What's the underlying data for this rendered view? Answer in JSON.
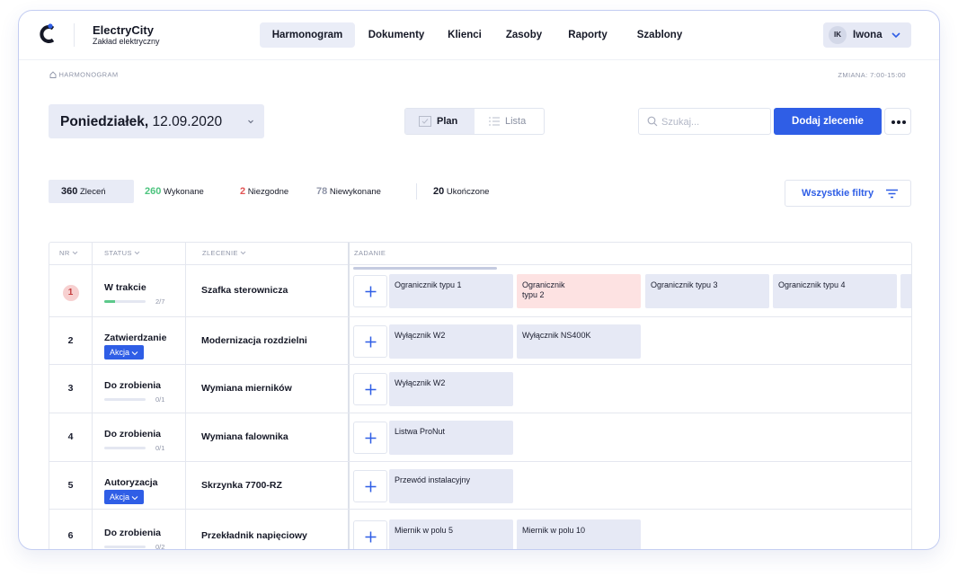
{
  "app": {
    "name": "ElectryCity",
    "subtitle": "Zakład elektryczny"
  },
  "nav": [
    "Harmonogram",
    "Dokumenty",
    "Klienci",
    "Zasoby",
    "Raporty",
    "Szablony"
  ],
  "nav_active": "Harmonogram",
  "user": {
    "initials": "IK",
    "name": "Iwona"
  },
  "breadcrumb": "HARMONOGRAM",
  "shift": "ZMIANA: 7:00-15:00",
  "date": {
    "day": "Poniedziałek,",
    "value": "12.09.2020"
  },
  "view_toggle": {
    "plan": "Plan",
    "list": "Lista",
    "active": "Plan"
  },
  "search": {
    "placeholder": "Szukaj..."
  },
  "add_button": "Dodaj zlecenie",
  "stats": [
    {
      "value": "360",
      "label": "Zleceń",
      "color": "#151826"
    },
    {
      "value": "260",
      "label": "Wykonane",
      "color": "#4cc47e"
    },
    {
      "value": "2",
      "label": "Niezgodne",
      "color": "#e25454"
    },
    {
      "value": "78",
      "label": "Niewykonane",
      "color": "#8f95a8"
    },
    {
      "value": "20",
      "label": "Ukończone",
      "color": "#151826"
    }
  ],
  "filters_button": "Wszystkie filtry",
  "columns": {
    "nr": "NR",
    "status": "STATUS",
    "order": "ZLECENIE",
    "task": "ZADANIE"
  },
  "colors": {
    "accent": "#2f5ee6",
    "task_bg": "#e6e9f5",
    "task_alert_bg": "#fde2e2",
    "progress": "#5cc98a",
    "badge_alert": "#f7d0d0"
  },
  "rows": [
    {
      "nr": "1",
      "alert": true,
      "status": "W trakcie",
      "progress": 0.25,
      "count": "2/7",
      "action": "",
      "order": "Szafka sterownicza",
      "tasks": [
        {
          "label": "Ogranicznik typu 1"
        },
        {
          "label": "Ogranicznik\ntypu 2",
          "alert": true
        },
        {
          "label": "Ogranicznik typu 3"
        },
        {
          "label": "Ogranicznik typu 4"
        },
        {
          "label": ""
        }
      ]
    },
    {
      "nr": "2",
      "alert": false,
      "status": "Zatwierdzanie",
      "progress": null,
      "count": "",
      "action": "Akcja",
      "order": "Modernizacja rozdzielni",
      "tasks": [
        {
          "label": "Wyłącznik W2"
        },
        {
          "label": "Wyłącznik NS400K"
        }
      ]
    },
    {
      "nr": "3",
      "alert": false,
      "status": "Do zrobienia",
      "progress": 0,
      "count": "0/1",
      "action": "",
      "order": "Wymiana mierników",
      "tasks": [
        {
          "label": "Wyłącznik W2"
        }
      ]
    },
    {
      "nr": "4",
      "alert": false,
      "status": "Do zrobienia",
      "progress": 0,
      "count": "0/1",
      "action": "",
      "order": "Wymiana falownika",
      "tasks": [
        {
          "label": "Listwa ProNut"
        }
      ]
    },
    {
      "nr": "5",
      "alert": false,
      "status": "Autoryzacja",
      "progress": null,
      "count": "",
      "action": "Akcja",
      "order": "Skrzynka 7700-RZ",
      "tasks": [
        {
          "label": "Przewód instalacyjny"
        }
      ]
    },
    {
      "nr": "6",
      "alert": false,
      "status": "Do zrobienia",
      "progress": 0,
      "count": "0/2",
      "action": "",
      "order": "Przekładnik napięciowy",
      "tasks": [
        {
          "label": "Miernik w polu 5"
        },
        {
          "label": "Miernik w polu 10"
        }
      ]
    }
  ]
}
